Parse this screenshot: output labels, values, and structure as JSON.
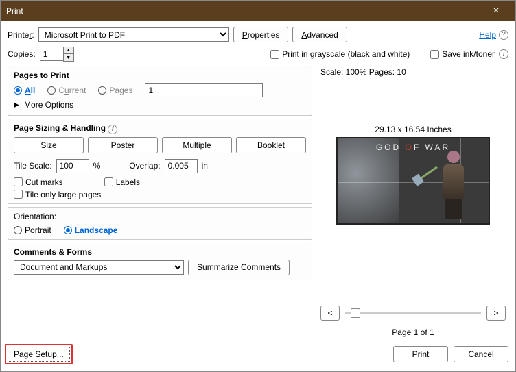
{
  "window": {
    "title": "Print"
  },
  "top": {
    "printer_label_pre": "Printe",
    "printer_label_u": "r",
    "printer_label_post": ":",
    "printer_value": "Microsoft Print to PDF",
    "properties_pre": "",
    "properties_u": "P",
    "properties_post": "roperties",
    "advanced_pre": "",
    "advanced_u": "A",
    "advanced_post": "dvanced",
    "help_pre": "",
    "help_u": "H",
    "help_post": "elp"
  },
  "row2": {
    "copies_pre": "",
    "copies_u": "C",
    "copies_post": "opies:",
    "copies_value": "1",
    "grayscale_label": "Print in gra",
    "grayscale_u": "y",
    "grayscale_post": "scale (black and white)",
    "saveink_label": "Save ink/toner"
  },
  "pages": {
    "heading": "Pages to Print",
    "all_u": "A",
    "all_post": "ll",
    "current_label": "C",
    "current_u": "u",
    "current_post": "rrent",
    "pages_label": "Pa",
    "pages_u": "g",
    "pages_post": "es",
    "pages_value": "1",
    "more_label": "More Options"
  },
  "sizing": {
    "heading": "Page Sizing & Handling",
    "size_pre": "S",
    "size_u": "i",
    "size_post": "ze",
    "poster_label": "Poster",
    "multiple_pre": "",
    "multiple_u": "M",
    "multiple_post": "ultiple",
    "booklet_pre": "",
    "booklet_u": "B",
    "booklet_post": "ooklet",
    "tilescale_label": "Tile Scale:",
    "tilescale_value": "100",
    "tilescale_unit": "%",
    "overlap_label": "Overlap:",
    "overlap_value": "0.005",
    "overlap_unit": "in",
    "cutmarks_label": "Cut marks",
    "labels_label": "Labels",
    "tileonly_label": "Tile only large pages"
  },
  "orient": {
    "heading": "Orientation:",
    "portrait_label": "P",
    "portrait_u": "o",
    "portrait_post": "rtrait",
    "landscape_label": "Lan",
    "landscape_u": "d",
    "landscape_post": "scape"
  },
  "comments": {
    "heading": "Comments & Forms",
    "value": "Document and Markups",
    "summarize_pre": "S",
    "summarize_u": "u",
    "summarize_post": "mmarize Comments"
  },
  "preview": {
    "scale_label": "Scale: 100% Pages: 10",
    "dims": "29.13 x 16.54 Inches",
    "gow_pre": "GOD ",
    "gow_o": "O",
    "gow_post": "F WAR",
    "pageof": "Page 1 of 1",
    "prev": "<",
    "next": ">"
  },
  "footer": {
    "pagesetup_label": "Page Set",
    "pagesetup_u": "u",
    "pagesetup_post": "p...",
    "print": "Print",
    "cancel": "Cancel"
  }
}
